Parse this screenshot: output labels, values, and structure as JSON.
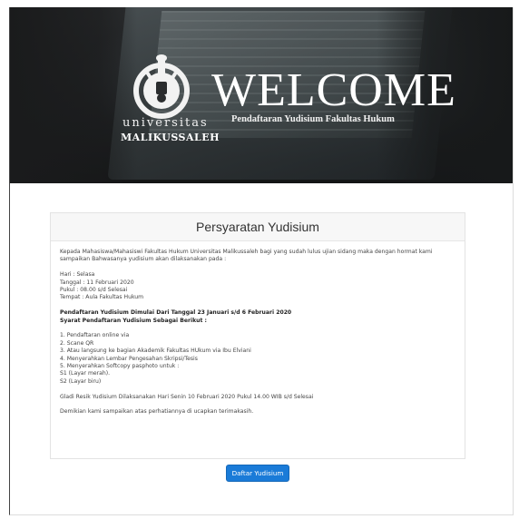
{
  "hero": {
    "welcome": "WELCOME",
    "subtitle": "Pendaftaran Yudisium Fakultas Hukum",
    "university_small": "universitas",
    "university_big": "MALIKUSSALEH"
  },
  "card": {
    "title": "Persyaratan Yudisium",
    "intro": "Kepada Mahasiswa/Mahasiswi Fakultas Hukum Universitas Malikussaleh bagi yang sudah lulus ujian sidang maka dengan hormat kami sampaikan Bahwasanya yudisium akan dilaksanakan pada :",
    "schedule": [
      "Hari : Selasa",
      "Tanggal : 11 Februari 2020",
      "Pukul : 08.00 s/d Selesai",
      "Tempat : Aula Fakultas Hukum"
    ],
    "registration_heading": "Pendaftaran Yudisium Dimulai Dari Tanggal 23 Januari s/d 6 Februari 2020",
    "requirements_heading": "Syarat Pendaftaran Yudisium Sebagai Berikut :",
    "requirements": [
      "1. Pendaftaran online via",
      "2. Scane QR",
      "3. Atau langsung ke bagian Akademik Fakultas HUkum via Ibu Elviani",
      "4. Menyerahkan Lembar Pengesahan Skripsi/Tesis",
      "5. Menyerahkan Softcopy pasphoto untuk :",
      "S1 (Layar merah).",
      "S2 (Layar biru)"
    ],
    "rehearsal": "Gladi Resik Yudisium Dilaksanakan Hari Senin 10 Februari 2020 Pukul 14.00 WIB s/d Selesai",
    "closing": "Demikian kami sampaikan atas perhatiannya di ucapkan terimakasih."
  },
  "button": {
    "label": "Daftar Yudisium"
  },
  "colors": {
    "button": "#1a7bd8",
    "hero_bg": "#1e2022"
  },
  "icons": {
    "logo": "university-seal-icon"
  }
}
